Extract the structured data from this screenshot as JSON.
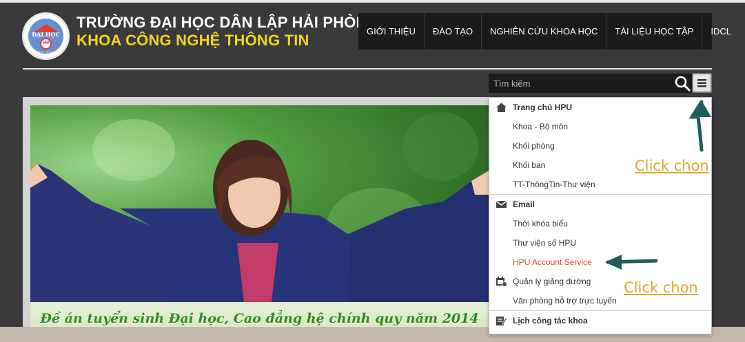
{
  "header": {
    "school_name": "TRƯỜNG ĐẠI HỌC DÂN LẬP HẢI PHÒNG",
    "faculty_name": "KHOA CÔNG NGHỆ THÔNG TIN",
    "logo_text": "ĐẠI HỌC",
    "logo_seal": "HP",
    "logo_motto": "HỌC - THỰC"
  },
  "nav": {
    "items": [
      {
        "label": "GIỚI THIỆU"
      },
      {
        "label": "ĐÀO TẠO"
      },
      {
        "label": "NGHIÊN CỨU KHOA HỌC"
      },
      {
        "label": "TÀI LIỆU HỌC TẬP"
      },
      {
        "label": "IDCL"
      }
    ]
  },
  "search": {
    "placeholder": "Tìm kiếm"
  },
  "banner": {
    "caption": "Đề án tuyển sinh Đại học, Cao đẳng hệ chính quy năm 2014"
  },
  "menu": {
    "items": [
      {
        "label": "Trang chủ HPU",
        "icon": "home-icon"
      },
      {
        "label": "Khoa - Bộ môn"
      },
      {
        "label": "Khối phòng"
      },
      {
        "label": "Khối ban"
      },
      {
        "label": "TT-ThôngTin-Thư viện"
      },
      {
        "label": "Email",
        "icon": "mail-icon"
      },
      {
        "label": "Thời khóa biểu"
      },
      {
        "label": "Thư viện số HPU"
      },
      {
        "label": "HPU Account Service"
      },
      {
        "label": "Quản lý giảng đường",
        "icon": "calendar-icon"
      },
      {
        "label": "Văn phòng hỗ trợ trực tuyến"
      },
      {
        "label": "Lịch công tác khoa",
        "icon": "edit-icon"
      }
    ]
  },
  "annotations": {
    "top": "Click chon",
    "bottom": "Click chon",
    "color": "#e0a62a",
    "arrow_color": "#1f5c5c"
  },
  "colors": {
    "header_bg": "#3a393c",
    "nav_bg": "#1b1b1d",
    "faculty_text": "#f2d31b",
    "highlight_item": "#d2512f",
    "caption_text": "#2f8c1f"
  }
}
